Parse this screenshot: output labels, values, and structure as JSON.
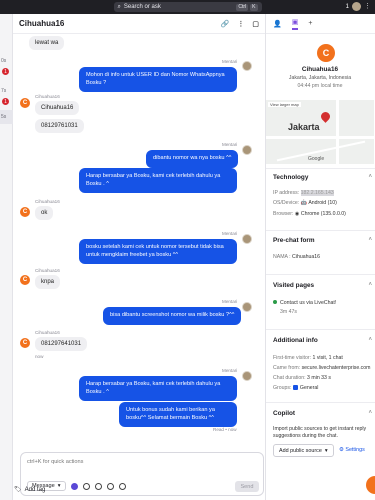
{
  "topbar": {
    "search_placeholder": "Search or ask",
    "kbd1": "Ctrl",
    "kbd2": "K",
    "notif": "1"
  },
  "left": {
    "items": [
      "0s",
      "1",
      "7s",
      "1",
      "5s"
    ]
  },
  "chat": {
    "title": "Cihuahua16",
    "customer_initial": "C",
    "messages": [
      {
        "dir": "in",
        "text": "lewat wa"
      },
      {
        "dir": "out",
        "meta": "Mentari",
        "text": "Mohon di info untuk USER ID dan Nomor WhatsAppnya Bosku ?"
      },
      {
        "dir": "in",
        "meta": "Cihuahua16",
        "text": "Cihuahua16"
      },
      {
        "dir": "in",
        "text": "08129761031"
      },
      {
        "dir": "out",
        "meta": "Mentari",
        "text": "dibantu nomor wa nya bosku ^^"
      },
      {
        "dir": "out",
        "text": "Harap bersabar ya Bosku, kami cek terlebih dahulu ya Bosku . ^"
      },
      {
        "dir": "in",
        "meta": "Cihuahua16",
        "text": "ok"
      },
      {
        "dir": "out",
        "meta": "Mentari",
        "text": "bosku setelah kami cek untuk nomor tersebut tidak bisa untuk mengklaim freebet ya bosku ^^"
      },
      {
        "dir": "in",
        "meta": "Cihuahua16",
        "text": "knpa"
      },
      {
        "dir": "out",
        "meta": "Mentari",
        "text": "bisa dibantu screenshot nomor wa milik bosku ?^^"
      },
      {
        "dir": "in",
        "meta": "Cihuahua16",
        "text": "081297641031"
      },
      {
        "dir": "out",
        "meta": "Mentari",
        "text": "Harap bersabar ya Bosku, kami cek terlebih dahulu ya Bosku . ^"
      },
      {
        "dir": "out",
        "text": "Untuk bonus sudah kami berikan ya bosku^^ Selamat bermain Bosku ^^"
      }
    ],
    "now_label": "now",
    "read_label": "Read • now",
    "composer_placeholder": "ctrl+K for quick actions",
    "message_type": "Message",
    "send_label": "Send",
    "add_tag": "Add tag"
  },
  "details": {
    "name": "Cihuahua16",
    "initial": "C",
    "location": "Jakarta, Jakarta, Indonesia",
    "local_time": "04:44 pm local time",
    "map": {
      "city": "Jakarta",
      "view_label": "View larger map",
      "google": "Google",
      "footer": "Keyboard shortcuts  Map data ©2025  Terms  Report a map error"
    },
    "technology": {
      "title": "Technology",
      "ip_label": "IP address:",
      "ip_value": "182.2.165.143",
      "os_label": "OS/Device:",
      "os_value": "Android (10)",
      "browser_label": "Browser:",
      "browser_value": "Chrome (135.0.0.0)"
    },
    "prechat": {
      "title": "Pre-chat form",
      "name_label": "NAMA :",
      "name_value": "Cihuahua16"
    },
    "visited": {
      "title": "Visited pages",
      "page": "Contact us via LiveChat!",
      "duration": "3m 47s"
    },
    "additional": {
      "title": "Additional info",
      "first_visit_label": "First-time visitor:",
      "first_visit_value": "1 visit, 1 chat",
      "came_from_label": "Came from:",
      "came_from_value": "secure.livechatenterprise.com",
      "duration_label": "Chat duration:",
      "duration_value": "3 min 33 s",
      "groups_label": "Groups:",
      "groups_value": "General"
    },
    "copilot": {
      "title": "Copilot",
      "desc": "Import public sources to get instant reply suggestions during the chat.",
      "add_source": "Add public source",
      "settings": "Settings"
    }
  }
}
